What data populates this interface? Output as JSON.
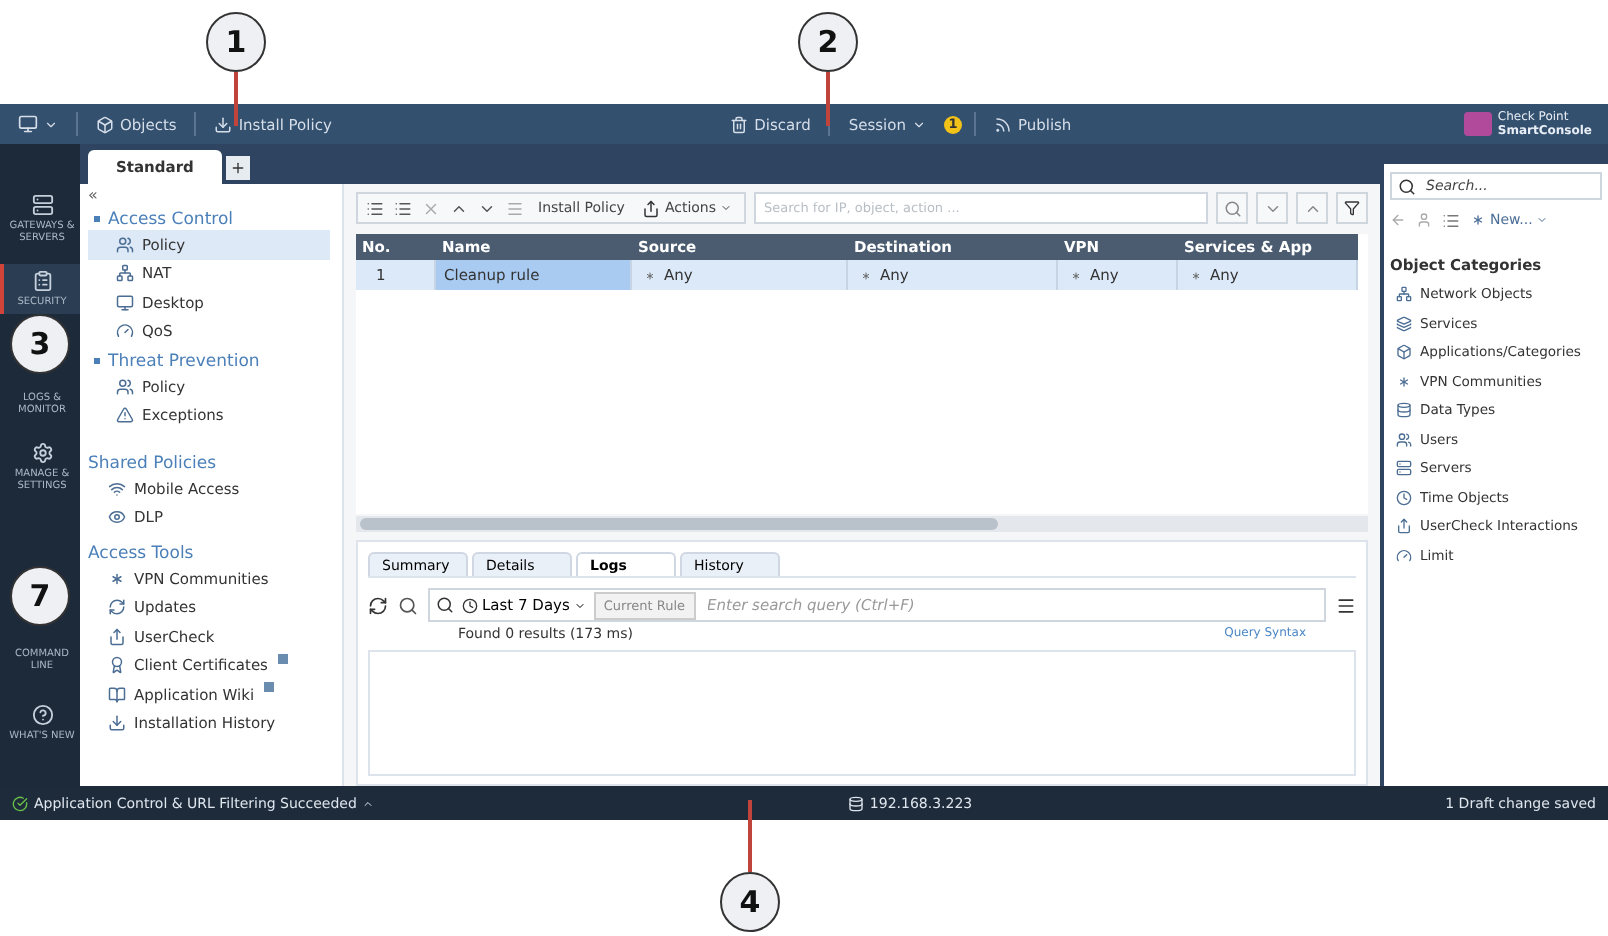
{
  "callouts": [
    {
      "label": "1",
      "kind": "down"
    },
    {
      "label": "2",
      "kind": "down"
    },
    {
      "label": "3",
      "kind": "none"
    },
    {
      "label": "7",
      "kind": "none"
    },
    {
      "label": "4",
      "kind": "up"
    }
  ],
  "header": {
    "objects": "Objects",
    "install": "Install Policy",
    "discard": "Discard",
    "session": "Session",
    "session_badge": "1",
    "publish": "Publish",
    "logo_line1": "Check Point",
    "logo_line2": "SmartConsole"
  },
  "nav": [
    {
      "label": "GATEWAYS & SERVERS",
      "selected": false
    },
    {
      "label": "SECURITY",
      "selected": true
    },
    {
      "label": "LOGS & MONITOR",
      "selected": false
    },
    {
      "label": "MANAGE & SETTINGS",
      "selected": false
    },
    {
      "label": "COMMAND LINE",
      "selected": false
    },
    {
      "label": "WHAT'S NEW",
      "selected": false
    }
  ],
  "policy_tabs": [
    {
      "label": "Standard",
      "selected": true
    }
  ],
  "tree": {
    "collapse": "«",
    "sections": [
      {
        "title": "Access Control",
        "items": [
          {
            "label": "Policy",
            "selected": true
          },
          {
            "label": "NAT",
            "selected": false
          },
          {
            "label": "Desktop",
            "selected": false
          },
          {
            "label": "QoS",
            "selected": false
          }
        ]
      },
      {
        "title": "Threat Prevention",
        "items": [
          {
            "label": "Policy",
            "selected": false
          },
          {
            "label": "Exceptions",
            "selected": false
          }
        ]
      }
    ],
    "shared_title": "Shared Policies",
    "shared": [
      "Mobile Access",
      "DLP"
    ],
    "tools_title": "Access Tools",
    "tools": [
      {
        "label": "VPN Communities",
        "badge": false
      },
      {
        "label": "Updates",
        "badge": false
      },
      {
        "label": "UserCheck",
        "badge": false
      },
      {
        "label": "Client Certificates",
        "badge": true
      },
      {
        "label": "Application Wiki",
        "badge": true
      },
      {
        "label": "Installation History",
        "badge": false
      }
    ]
  },
  "toolbar": {
    "install": "Install Policy",
    "actions": "Actions",
    "search_placeholder": "Search for IP, object, action ..."
  },
  "table": {
    "columns": [
      "No.",
      "Name",
      "Source",
      "Destination",
      "VPN",
      "Services & App"
    ],
    "rows": [
      {
        "cells": [
          "1",
          "Cleanup rule",
          "Any",
          "Any",
          "Any",
          "Any"
        ],
        "selected": true
      }
    ]
  },
  "details": {
    "tabs": [
      {
        "label": "Summary",
        "selected": false
      },
      {
        "label": "Details",
        "selected": false
      },
      {
        "label": "Logs",
        "selected": true
      },
      {
        "label": "History",
        "selected": false
      }
    ],
    "range": "Last 7 Days",
    "rule_filter": "Current Rule",
    "query_placeholder": "Enter search query (Ctrl+F)",
    "results": "Found 0 results (173 ms)",
    "query_syntax": "Query Syntax"
  },
  "objects_panel": {
    "search_placeholder": "Search...",
    "new": "New...",
    "title": "Object Categories",
    "items": [
      "Network Objects",
      "Services",
      "Applications/Categories",
      "VPN Communities",
      "Data Types",
      "Users",
      "Servers",
      "Time Objects",
      "UserCheck Interactions",
      "Limit"
    ]
  },
  "status_bar": {
    "left": "Application Control & URL Filtering Succeeded",
    "server": "192.168.3.223",
    "right": "1 Draft change saved"
  }
}
